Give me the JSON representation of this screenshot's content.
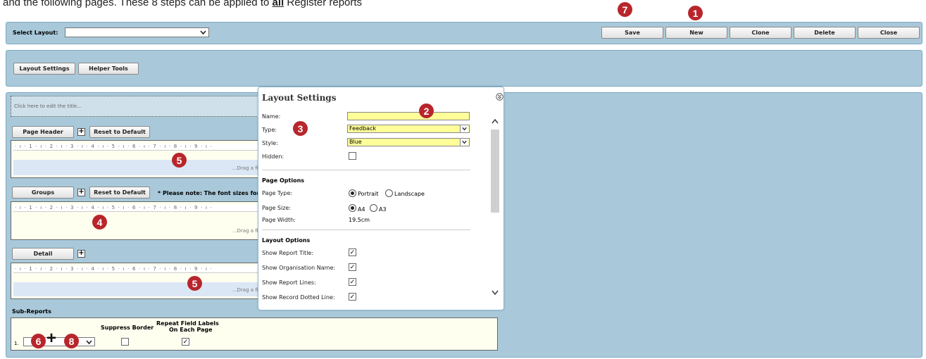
{
  "intro": {
    "text_before": "and the following pages. These 8 steps can be applied to ",
    "text_bold": "all",
    "text_after": " Register reports"
  },
  "toolbar": {
    "select_layout_label": "Select Layout:",
    "select_layout_value": "",
    "save_label": "Save",
    "new_label": "New",
    "clone_label": "Clone",
    "delete_label": "Delete",
    "close_label": "Close"
  },
  "tabs": {
    "layout_settings_label": "Layout Settings",
    "helper_tools_label": "Helper Tools"
  },
  "designer": {
    "title_placeholder": "Click here to edit the title...",
    "ruler_text": "· ı · 1 · ı · 2 · ı · 3 · ı · 4 · ı · 5 · ı · 6 · ı · 7 · ı · 8 · ı · 9 · ı ·",
    "page_header": {
      "label": "Page Header",
      "plus": "+",
      "reset_label": "Reset to Default",
      "drag_text": "...Drag a fie"
    },
    "groups": {
      "label": "Groups",
      "plus": "+",
      "reset_label": "Reset to Default",
      "note": "* Please note: The font sizes for",
      "drag_text": "...Drag a fie"
    },
    "detail": {
      "label": "Detail",
      "plus": "+",
      "drag_text": "...Drag a fie"
    },
    "sub_reports": {
      "heading": "Sub-Reports",
      "col_suppress": "Suppress Border",
      "col_repeat_line1": "Repeat Field Labels",
      "col_repeat_line2": "On Each Page",
      "row_index": "1.",
      "row_suppress_checked": false,
      "row_repeat_checked": true
    }
  },
  "layout_settings": {
    "title": "Layout Settings",
    "name_label": "Name:",
    "name_value": "",
    "type_label": "Type:",
    "type_value": "Feedback",
    "style_label": "Style:",
    "style_value": "Blue",
    "hidden_label": "Hidden:",
    "hidden_checked": false,
    "page_options_heading": "Page Options",
    "page_type_label": "Page Type:",
    "portrait_label": "Portrait",
    "landscape_label": "Landscape",
    "page_type_selected": "Portrait",
    "page_size_label": "Page Size:",
    "a4_label": "A4",
    "a3_label": "A3",
    "page_size_selected": "A4",
    "page_width_label": "Page Width:",
    "page_width_value": "19.5cm",
    "layout_options_heading": "Layout Options",
    "options": [
      {
        "label": "Show Report Title:",
        "checked": true
      },
      {
        "label": "Show Organisation Name:",
        "checked": true
      },
      {
        "label": "Show Report Lines:",
        "checked": true
      },
      {
        "label": "Show Record Dotted Line:",
        "checked": true
      }
    ]
  },
  "markers": {
    "m1": "1",
    "m2": "2",
    "m3": "3",
    "m4": "4",
    "m5a": "5",
    "m5b": "5",
    "m6": "6",
    "m7": "7",
    "m8": "8",
    "plus_sign": "+",
    "color": "#b8262c"
  },
  "colors": {
    "panel": "#a9c9da",
    "field_highlight": "#ffff9a",
    "section_bg": "#fffff0"
  }
}
